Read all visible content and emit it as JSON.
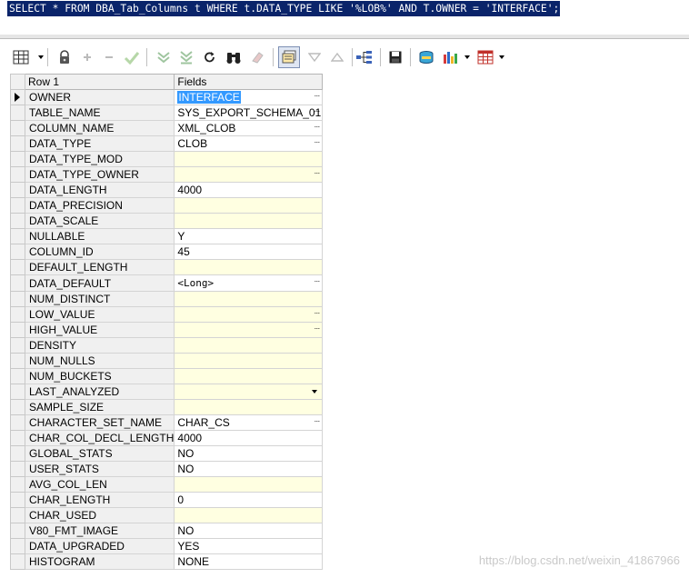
{
  "sql_editor": {
    "query": "SELECT * FROM DBA_Tab_Columns t WHERE t.DATA_TYPE LIKE '%LOB%' AND T.OWNER = 'INTERFACE';"
  },
  "toolbar": {
    "icons": [
      "grid-layout-icon",
      "lock-icon",
      "add-record-icon",
      "delete-record-icon",
      "post-edit-icon",
      "fetch-next-icon",
      "fetch-last-icon",
      "refresh-icon",
      "find-icon",
      "clear-icon",
      "single-record-view-icon",
      "sort-down-icon",
      "sort-up-icon",
      "query-builder-icon",
      "save-icon",
      "export-icon",
      "chart-icon",
      "table-icon"
    ]
  },
  "grid": {
    "header": {
      "row_label": "Row 1",
      "fields_label": "Fields"
    },
    "rows": [
      {
        "name": "OWNER",
        "value": "INTERFACE",
        "selected": true,
        "ellipsis": true
      },
      {
        "name": "TABLE_NAME",
        "value": "SYS_EXPORT_SCHEMA_01",
        "ellipsis": true
      },
      {
        "name": "COLUMN_NAME",
        "value": "XML_CLOB",
        "ellipsis": true
      },
      {
        "name": "DATA_TYPE",
        "value": "CLOB",
        "ellipsis": true
      },
      {
        "name": "DATA_TYPE_MOD",
        "value": ""
      },
      {
        "name": "DATA_TYPE_OWNER",
        "value": "",
        "ellipsis": true
      },
      {
        "name": "DATA_LENGTH",
        "value": "4000"
      },
      {
        "name": "DATA_PRECISION",
        "value": ""
      },
      {
        "name": "DATA_SCALE",
        "value": ""
      },
      {
        "name": "NULLABLE",
        "value": "Y"
      },
      {
        "name": "COLUMN_ID",
        "value": "45"
      },
      {
        "name": "DEFAULT_LENGTH",
        "value": ""
      },
      {
        "name": "DATA_DEFAULT",
        "value": "<Long>",
        "mono": true,
        "ellipsis": true
      },
      {
        "name": "NUM_DISTINCT",
        "value": ""
      },
      {
        "name": "LOW_VALUE",
        "value": "",
        "ellipsis": true
      },
      {
        "name": "HIGH_VALUE",
        "value": "",
        "ellipsis": true
      },
      {
        "name": "DENSITY",
        "value": ""
      },
      {
        "name": "NUM_NULLS",
        "value": ""
      },
      {
        "name": "NUM_BUCKETS",
        "value": ""
      },
      {
        "name": "LAST_ANALYZED",
        "value": "",
        "dropdown": true
      },
      {
        "name": "SAMPLE_SIZE",
        "value": ""
      },
      {
        "name": "CHARACTER_SET_NAME",
        "value": "CHAR_CS",
        "ellipsis": true
      },
      {
        "name": "CHAR_COL_DECL_LENGTH",
        "value": "4000"
      },
      {
        "name": "GLOBAL_STATS",
        "value": "NO"
      },
      {
        "name": "USER_STATS",
        "value": "NO"
      },
      {
        "name": "AVG_COL_LEN",
        "value": ""
      },
      {
        "name": "CHAR_LENGTH",
        "value": "0"
      },
      {
        "name": "CHAR_USED",
        "value": ""
      },
      {
        "name": "V80_FMT_IMAGE",
        "value": "NO"
      },
      {
        "name": "DATA_UPGRADED",
        "value": "YES"
      },
      {
        "name": "HISTOGRAM",
        "value": "NONE"
      }
    ]
  },
  "watermark": "https://blog.csdn.net/weixin_41867966",
  "colors": {
    "selection": "#0a246a",
    "empty_cell": "#ffffe1",
    "selected_text": "#3399ff"
  }
}
